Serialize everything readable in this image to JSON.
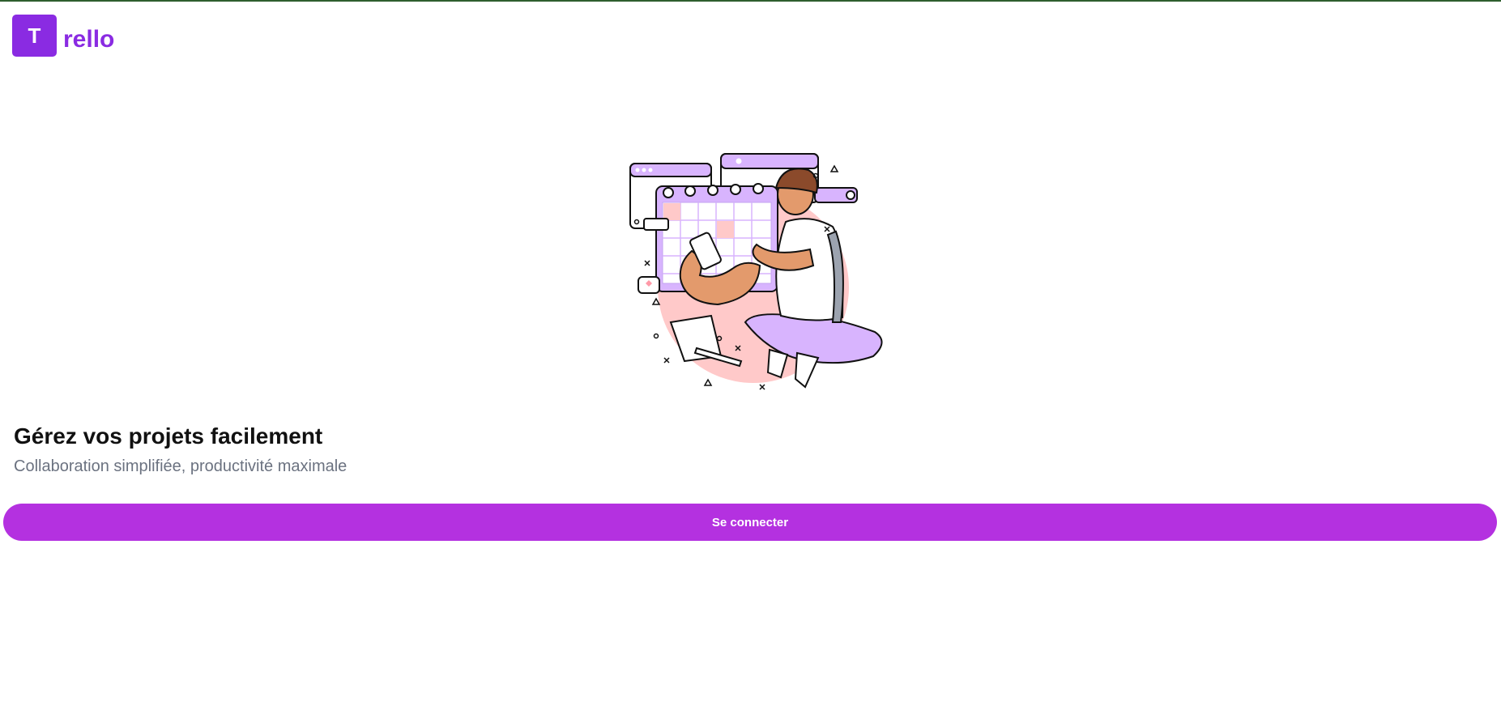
{
  "brand": {
    "badge_letter": "T",
    "wordmark": "rello",
    "color": "#8a2be2"
  },
  "hero": {
    "illustration_icon": "person-with-calendar-illustration",
    "title": "Gérez vos projets facilement",
    "subtitle": "Collaboration simplifiée, productivité maximale"
  },
  "login_button": {
    "label": "Se connecter",
    "color": "#b431e0"
  }
}
